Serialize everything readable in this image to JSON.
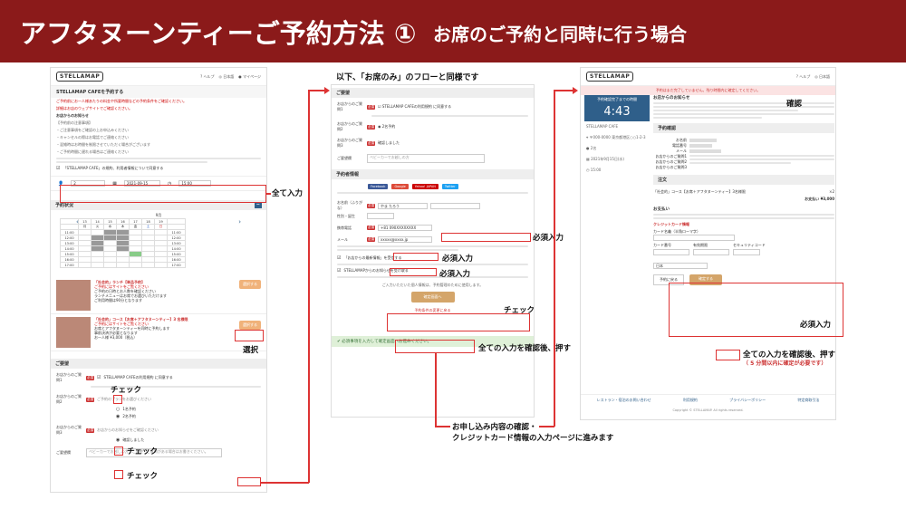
{
  "banner": {
    "title": "アフタヌーンティーご予約方法 ①",
    "subtitle": "お席のご予約と同時に行う場合"
  },
  "colors": {
    "banner": "#8b1a1a",
    "annotation_box": "#d33",
    "orange_button": "#f0b27a",
    "timer_blue": "#2f5f8a"
  },
  "icons": [
    "help-icon",
    "user-icon",
    "mypage-icon",
    "calendar-icon",
    "clock-icon",
    "minus-icon",
    "check-icon",
    "location-icon",
    "phone-icon"
  ],
  "col1": {
    "logo": "STELLAMAP",
    "nav": [
      "ヘルプ",
      "日本語",
      "マイページ"
    ],
    "page_title": "STELLAMAP CAFEを予約する",
    "intro": [
      "ご予約前にお一人様あたりの料金や所要時間などの予約条件をご確認ください。",
      "詳細はお店のウェブサイトでご確認ください。"
    ],
    "notes_title": "お店からのお知らせ",
    "notes": [
      "【予約前の注意事項】",
      "・ご注意事項をご確認の上お申込みください",
      "・キャンセルの際はお電話でご連絡ください",
      "・混雑時はお時間を制限させていただく場合がございます",
      "・ご予約時間に遅れる場合はご連絡ください"
    ],
    "agree_label": "「STELLAMAP CAFE」の規約、利用者情報について同意する",
    "people": "2",
    "date": "2021-09-15",
    "time": "15:00",
    "availability_title": "予約状況",
    "month": "9月",
    "days": [
      "月",
      "火",
      "水",
      "木",
      "金",
      "土",
      "日"
    ],
    "dates": [
      "13",
      "14",
      "15",
      "16",
      "17",
      "18",
      "19"
    ],
    "times": [
      "11:00",
      "12:00",
      "13:00",
      "14:00",
      "15:00",
      "16:00",
      "17:00",
      "18:00"
    ],
    "plans": [
      {
        "name": "「社会的」ランチ【単品予約】",
        "tag": "ご予約にはサイトをご覧ください",
        "desc": [
          "ご予約の日時とお人数を確認ください",
          "ランチメニューはお席でお選びいただけます",
          "ご利用時間は90分となります"
        ],
        "btn": "選択する"
      },
      {
        "name": "「社会的」コース【お席＋アフタヌーンティー】3 名様限",
        "tag": "ご予約にはサイトをご覧ください",
        "desc": [
          "お席とアフタヌーンティーを同時に予約します",
          "事前決済が必要となります",
          "お一人様 ¥3,000（税込）"
        ],
        "btn": "選択する"
      }
    ],
    "req_title": "ご要望",
    "req1_label": "お店からのご質問1",
    "req1_text": "STELLAMAP CAFEの利用規約 に同意する",
    "req2_label": "お店からのご質問2",
    "req2_options": [
      "1名予約",
      "2名予約"
    ],
    "req3_label": "お店からのご質問3",
    "req3_text": "確認しました",
    "comment_label": "ご要望欄",
    "comment_placeholder": "ベビーカーでお越しの方、ご要望・ご質問がある場合はお書きください。"
  },
  "col2": {
    "req_title": "ご要望",
    "req_labels": [
      "お店からのご質問1",
      "お店からのご質問2",
      "お店からのご質問3",
      "ご要望欄"
    ],
    "confirm_text": "確認しました",
    "customer_title": "予約者情報",
    "login_label": "ログイン",
    "social": [
      "Facebook",
      "Google",
      "Yahoo! JAPAN",
      "Twitter"
    ],
    "name_label": "お名前（ふりがな）",
    "name_value": "やま たろう",
    "gender_label": "性別・誕生",
    "phone_label": "携帯電話",
    "phone_value": "+81 090XXXXXXXX",
    "email_label": "メール",
    "email_value": "xxxxx@xxxx.jp",
    "check1": "「お店からの最新情報」を受信する",
    "check2": "STELLAMAPからのお知らせを受け取る",
    "submit_note": "ご入力いただいた個人情報は、予約管理のために使用します。",
    "submit": "確定画面へ",
    "back": "予約条件の変更に戻る",
    "alert": "必須事項を入力して確定画面へお進みください。"
  },
  "col3": {
    "logo": "STELLAMAP",
    "nav": [
      "ヘルプ",
      "日本語"
    ],
    "top_note": "予約はまだ完了していません。残り時間内に確定してください。",
    "timer_label": "予約確認完了までの時間",
    "timer": "4:43",
    "shop": "STELLAMAP CAFE",
    "address": "〒000-0000 東京都港区○○1-2-3",
    "people": "2名",
    "datetime": "2021年9月15日(水)",
    "time": "15:00",
    "notes_title": "お店からのお知らせ",
    "confirm_title": "予約確認",
    "confirm_labels": [
      "お名前",
      "電話番号",
      "メール",
      "お店からのご質問1",
      "お店からのご質問2",
      "お店からのご質問3"
    ],
    "plan_title": "注文",
    "plan_name": "「社会的」コース【お席＋アフタヌーンティー】3名様限",
    "qty": "×2",
    "total": "お支払い ¥3,000",
    "payment_title": "お支払い",
    "card_title": "クレジットカード情報",
    "card_labels": [
      "カード名義（半角ローマ字）",
      "カード番号",
      "有効期限",
      "セキュリティコード"
    ],
    "country": "日本",
    "back": "予約に戻る",
    "confirm_btn": "確定する",
    "footer": [
      "レストラン・宿泊のお問い合わせ",
      "利用規約",
      "プライバシーポリシー",
      "特定商取引法"
    ],
    "copyright": "Copyright © STELLAMAP. All rights reserved."
  },
  "annotations": {
    "all_input": "全て入力",
    "select": "選択",
    "check1": "チェック",
    "check2": "チェック",
    "check3": "チェック",
    "same_flow": "以下、「お席のみ」のフローと同様です",
    "required1": "必須入力",
    "required2": "必須入力",
    "required3": "必須入力",
    "check4": "チェック",
    "confirm_all": "全ての入力を確認後、押す",
    "next_page_1": "お申し込み内容の確認・",
    "next_page_2": "クレジットカード情報の入力ページに進みます",
    "kakunin": "確認",
    "required4": "必須入力",
    "confirm_all2": "全ての入力を確認後、押す",
    "time_limit": "（ 5 分間以内に確定が必要です）"
  }
}
